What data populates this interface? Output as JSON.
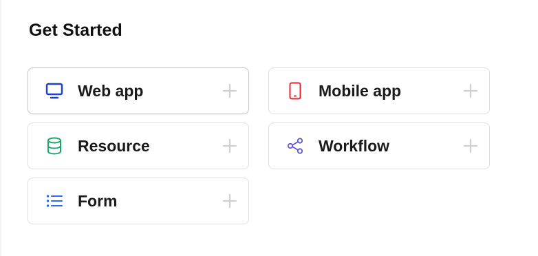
{
  "section": {
    "title": "Get Started"
  },
  "cards": [
    {
      "label": "Web app",
      "icon": "monitor-icon",
      "color": "#1d3fd1"
    },
    {
      "label": "Mobile app",
      "icon": "mobile-phone-icon",
      "color": "#e5262e"
    },
    {
      "label": "Resource",
      "icon": "database-icon",
      "color": "#16a86a"
    },
    {
      "label": "Workflow",
      "icon": "share-nodes-icon",
      "color": "#5d55d6"
    },
    {
      "label": "Form",
      "icon": "list-icon",
      "color": "#2e6be6"
    }
  ],
  "colors": {
    "border": "#dedede",
    "plus": "#cfcfcf",
    "text": "#1a1a1a"
  }
}
